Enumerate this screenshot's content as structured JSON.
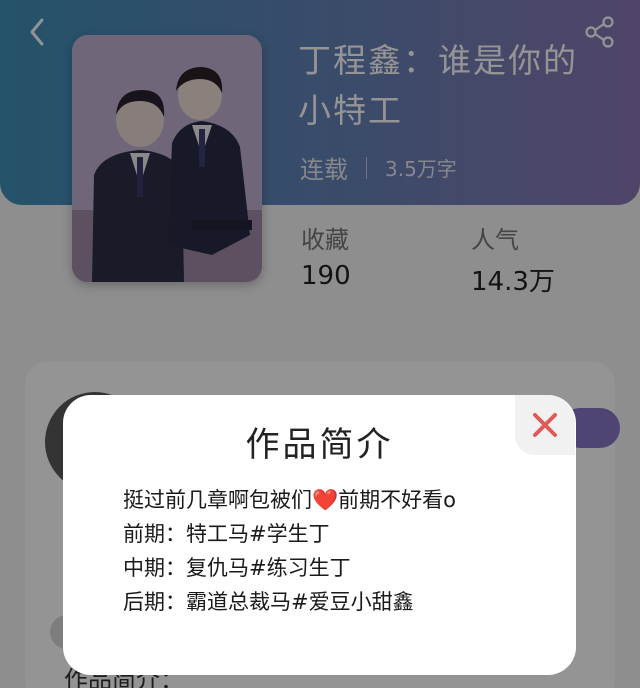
{
  "book": {
    "title": "丁程鑫：谁是你的小特工",
    "status": "连载",
    "word_count": "3.5万字"
  },
  "stats": {
    "favorites_label": "收藏",
    "favorites_value": "190",
    "popularity_label": "人气",
    "popularity_value": "14.3万"
  },
  "page_bottom_label": "作品简介：",
  "modal": {
    "title": "作品简介",
    "lines": [
      {
        "before": "挺过前几章啊包被们",
        "emoji": "❤️",
        "after": "前期不好看o"
      },
      {
        "text": "前期：特工马#学生丁"
      },
      {
        "text": "中期：复仇马#练习生丁"
      },
      {
        "text": "后期：霸道总裁马#爱豆小甜鑫"
      }
    ]
  },
  "icons": {
    "back": "chevron-left-icon",
    "share": "share-icon",
    "close": "close-icon"
  },
  "colors": {
    "close_x": "#e05a5a",
    "header_start": "#3f8fb6",
    "header_end": "#8a77b4"
  }
}
